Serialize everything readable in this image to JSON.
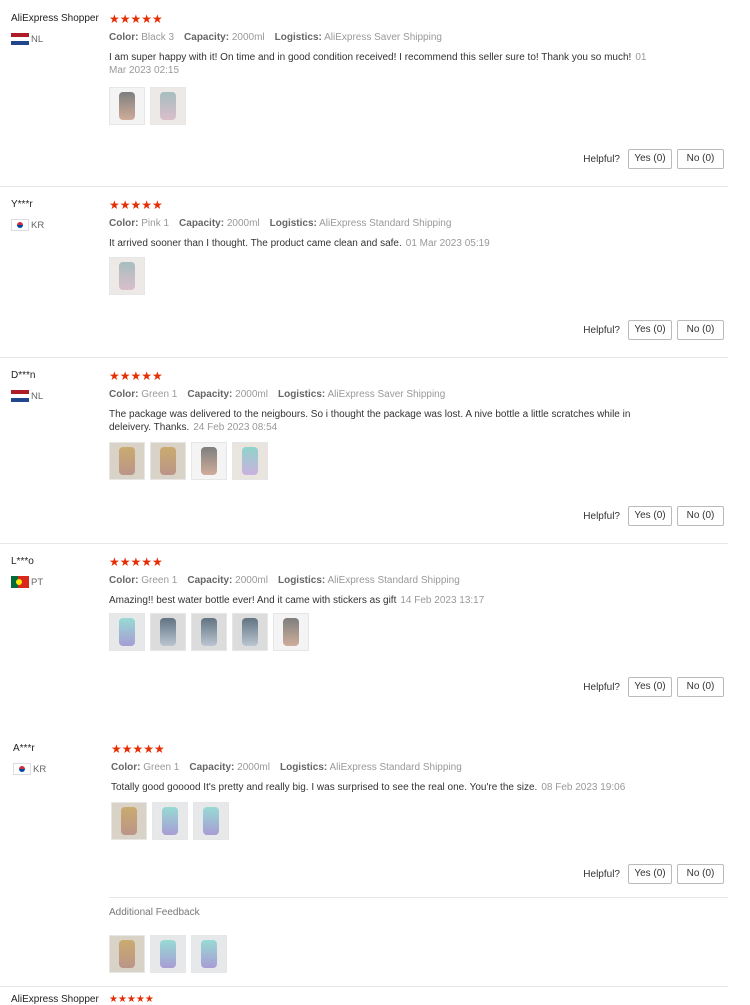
{
  "colors": {
    "star": "#e62e04",
    "meta_label": "#666666",
    "meta_value": "#999999"
  },
  "labels": {
    "color": "Color:",
    "capacity": "Capacity:",
    "logistics": "Logistics:",
    "helpful": "Helpful?",
    "yes": "Yes (0)",
    "no": "No (0)",
    "additional_feedback": "Additional Feedback"
  },
  "reviews": [
    {
      "user": "AliExpress Shopper",
      "country": "NL",
      "stars": "★★★★★",
      "rating": 5,
      "color": "Black 3",
      "capacity": "2000ml",
      "logistics": "AliExpress Saver Shipping",
      "text": "I am super happy with it! On time and in good condition received! I recommend this seller sure to! Thank you so much!",
      "date": "01 Mar 2023 02:15",
      "photo_count": 2
    },
    {
      "user": "Y***r",
      "country": "KR",
      "stars": "★★★★★",
      "rating": 5,
      "color": "Pink 1",
      "capacity": "2000ml",
      "logistics": "AliExpress Standard Shipping",
      "text": "It arrived sooner than I thought. The product came clean and safe.",
      "date": "01 Mar 2023 05:19",
      "photo_count": 1
    },
    {
      "user": "D***n",
      "country": "NL",
      "stars": "★★★★★",
      "rating": 5,
      "color": "Green 1",
      "capacity": "2000ml",
      "logistics": "AliExpress Saver Shipping",
      "text": "The package was delivered to the neigbours. So i thought the package was lost. A nive bottle a little scratches while in deleivery. Thanks.",
      "date": "24 Feb 2023 08:54",
      "photo_count": 4
    },
    {
      "user": "L***o",
      "country": "PT",
      "stars": "★★★★★",
      "rating": 5,
      "color": "Green 1",
      "capacity": "2000ml",
      "logistics": "AliExpress Standard Shipping",
      "text": "Amazing!! best water bottle ever! And it came with stickers as gift",
      "date": "14 Feb 2023 13:17",
      "photo_count": 5
    },
    {
      "user": "A***r",
      "country": "KR",
      "stars": "★★★★★",
      "rating": 5,
      "color": "Green 1",
      "capacity": "2000ml",
      "logistics": "AliExpress Standard Shipping",
      "text": "Totally good gooood It's pretty and really big. I was surprised to see the real one. You're the size.",
      "date": "08 Feb 2023 19:06",
      "photo_count": 3,
      "additional_photo_count": 3
    }
  ],
  "partial_review": {
    "user": "AliExpress Shopper",
    "stars": "★★★★★"
  }
}
